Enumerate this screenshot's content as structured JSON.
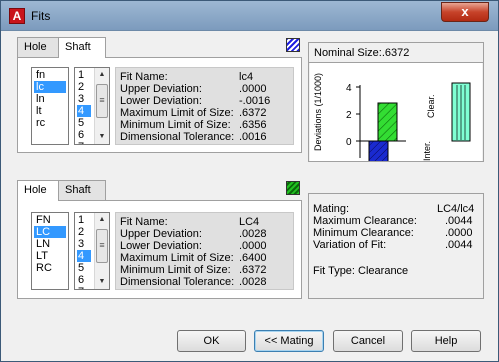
{
  "window": {
    "title": "Fits",
    "close": "x",
    "app_icon_letter": "A"
  },
  "shaft_section": {
    "tabs": [
      "Hole",
      "Shaft"
    ],
    "active_tab": "Shaft",
    "swatch_color": "#2020e0",
    "fits": [
      "fn",
      "lc",
      "ln",
      "lt",
      "rc"
    ],
    "selected_fit": "lc",
    "grades": [
      "1",
      "2",
      "3",
      "4",
      "5",
      "6",
      "7"
    ],
    "selected_grade": "4",
    "info": [
      {
        "label": "Fit Name:",
        "value": "lc4"
      },
      {
        "label": "Upper Deviation:",
        "value": ".0000"
      },
      {
        "label": "Lower Deviation:",
        "value": "-.0016"
      },
      {
        "label": "Maximum Limit of Size:",
        "value": ".6372"
      },
      {
        "label": "Minimum Limit of Size:",
        "value": ".6356"
      },
      {
        "label": "Dimensional Tolerance:",
        "value": ".0016"
      }
    ]
  },
  "hole_section": {
    "tabs": [
      "Hole",
      "Shaft"
    ],
    "active_tab": "Hole",
    "swatch_color": "#22c022",
    "fits": [
      "FN",
      "LC",
      "LN",
      "LT",
      "RC"
    ],
    "selected_fit": "LC",
    "grades": [
      "1",
      "2",
      "3",
      "4",
      "5",
      "6",
      "7"
    ],
    "selected_grade": "4",
    "info": [
      {
        "label": "Fit Name:",
        "value": "LC4"
      },
      {
        "label": "Upper Deviation:",
        "value": ".0028"
      },
      {
        "label": "Lower Deviation:",
        "value": ".0000"
      },
      {
        "label": "Maximum Limit of Size:",
        "value": ".6400"
      },
      {
        "label": "Minimum Limit of Size:",
        "value": ".6372"
      },
      {
        "label": "Dimensional Tolerance:",
        "value": ".0028"
      }
    ]
  },
  "chart": {
    "nominal_label": "Nominal Size:.6372",
    "ylabel": "Deviations (1/1000)",
    "clear_label": "Clear.",
    "inter_label": "Inter.",
    "ticks": [
      "4",
      "2",
      "0",
      "-2"
    ],
    "hole_color": "#33dd33",
    "shaft_color": "#1a2ad0",
    "clear_color": "#7fffd4"
  },
  "mating": {
    "rows": [
      {
        "label": "Mating:",
        "value": "LC4/lc4"
      },
      {
        "label": "Maximum Clearance:",
        "value": ".0044"
      },
      {
        "label": "Minimum Clearance:",
        "value": ".0000"
      },
      {
        "label": "Variation of Fit:",
        "value": ".0044"
      }
    ],
    "fit_type": "Fit Type: Clearance"
  },
  "buttons": {
    "ok": "OK",
    "mating": "<< Mating",
    "cancel": "Cancel",
    "help": "Help"
  }
}
